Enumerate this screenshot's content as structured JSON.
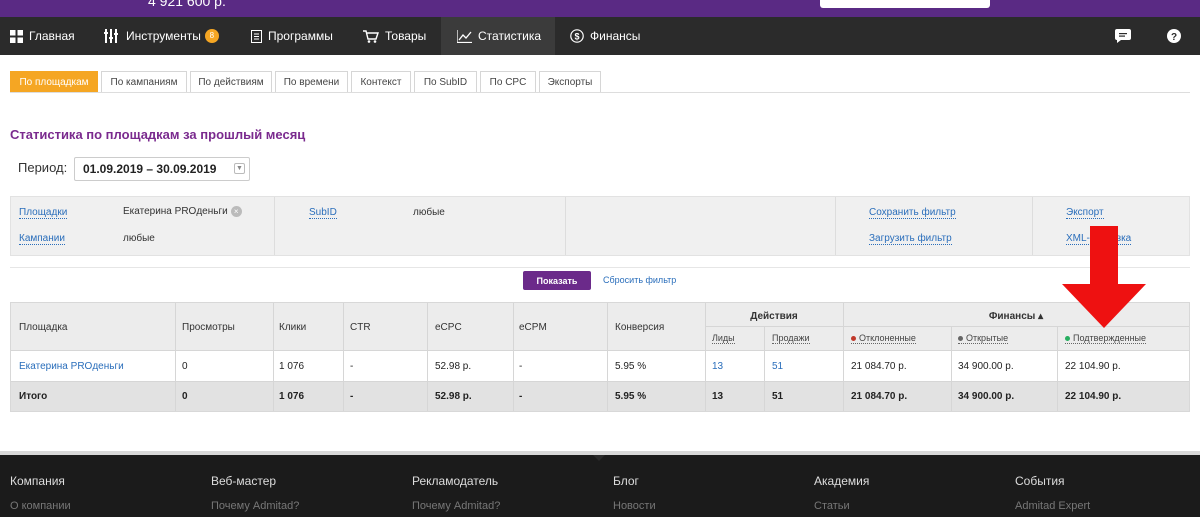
{
  "topbar": {
    "balance": "4 921 600 р."
  },
  "nav": {
    "items": [
      "Главная",
      "Инструменты",
      "Программы",
      "Товары",
      "Статистика",
      "Финансы"
    ],
    "tools_badge": "8",
    "active": "Статистика"
  },
  "tabs": [
    "По площадкам",
    "По кампаниям",
    "По действиям",
    "По времени",
    "Контекст",
    "По SubID",
    "По CPC",
    "Экспорты"
  ],
  "page": {
    "title": "Статистика по площадкам за прошлый месяц",
    "period_label": "Период:",
    "period_value": "01.09.2019 – 30.09.2019"
  },
  "filter": {
    "platforms_label": "Площадки",
    "platforms_value": "Екатерина PROденьги",
    "campaigns_label": "Кампании",
    "campaigns_value": "любые",
    "subid_label": "SubID",
    "subid_value": "любые",
    "save_filter": "Сохранить фильтр",
    "load_filter": "Загрузить фильтр",
    "export": "Экспорт",
    "xml": "XML-выгрузка"
  },
  "actions": {
    "show": "Показать",
    "reset": "Сбросить фильтр"
  },
  "table": {
    "headers": {
      "platform": "Площадка",
      "views": "Просмотры",
      "clicks": "Клики",
      "ctr": "CTR",
      "ecpc": "eCPC",
      "ecpm": "eCPM",
      "conversion": "Конверсия",
      "actions_group": "Действия",
      "leads": "Лиды",
      "sales": "Продажи",
      "finance_group": "Финансы ▴",
      "rejected": "Отклоненные",
      "open": "Открытые",
      "confirmed": "Подтвержденные"
    },
    "row": {
      "platform": "Екатерина PROденьги",
      "views": "0",
      "clicks": "1 076",
      "ctr": "-",
      "ecpc": "52.98 р.",
      "ecpm": "-",
      "conversion": "5.95 %",
      "leads": "13",
      "sales": "51",
      "rejected": "21 084.70 р.",
      "open": "34 900.00 р.",
      "confirmed": "22 104.90 р."
    },
    "total": {
      "platform": "Итого",
      "views": "0",
      "clicks": "1 076",
      "ctr": "-",
      "ecpc": "52.98 р.",
      "ecpm": "-",
      "conversion": "5.95 %",
      "leads": "13",
      "sales": "51",
      "rejected": "21 084.70 р.",
      "open": "34 900.00 р.",
      "confirmed": "22 104.90 р."
    }
  },
  "colors": {
    "accent": "#f5a623",
    "brand": "#6b2a8a",
    "arrow": "#ee1111",
    "rejected_dot": "#c0392b",
    "open_dot": "#666666",
    "confirmed_dot": "#27ae60"
  },
  "footer": {
    "columns": [
      {
        "title": "Компания",
        "link": "О компании"
      },
      {
        "title": "Веб-мастер",
        "link": "Почему Admitad?"
      },
      {
        "title": "Рекламодатель",
        "link": "Почему Admitad?"
      },
      {
        "title": "Блог",
        "link": "Новости"
      },
      {
        "title": "Академия",
        "link": "Статьи"
      },
      {
        "title": "События",
        "link": "Admitad Expert"
      }
    ]
  }
}
